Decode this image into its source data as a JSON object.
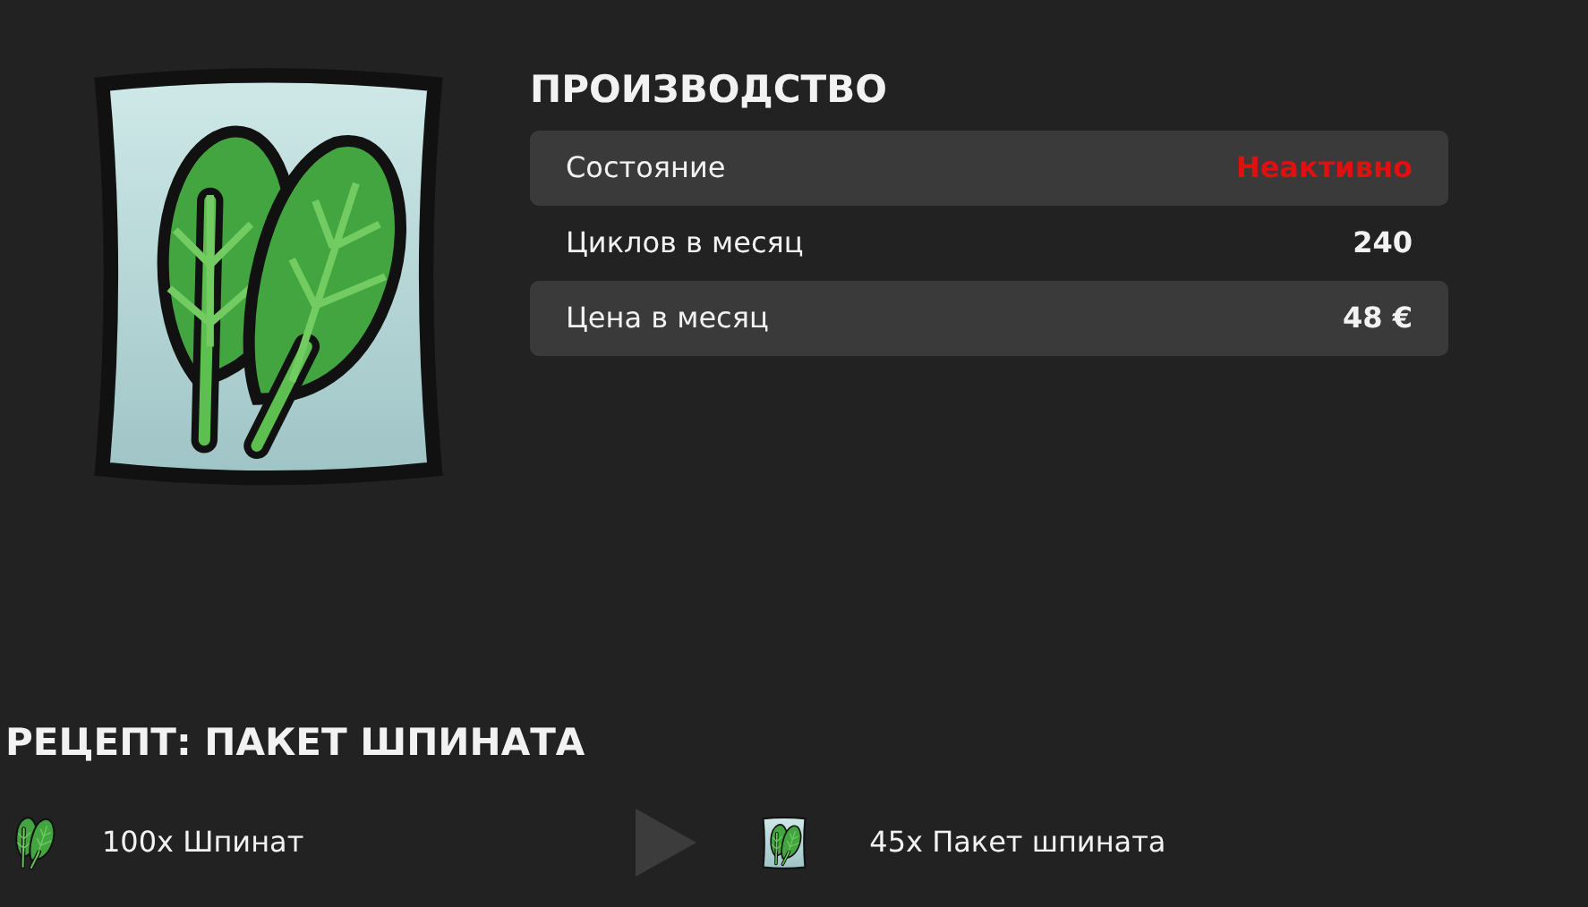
{
  "production": {
    "title": "ПРОИЗВОДСТВО",
    "rows": [
      {
        "label": "Состояние",
        "value": "Неактивно",
        "kind": "status",
        "active": false
      },
      {
        "label": "Циклов в месяц",
        "value": "240",
        "kind": "plain"
      },
      {
        "label": "Цена в месяц",
        "value": "48 €",
        "kind": "plain"
      }
    ]
  },
  "recipe": {
    "title": "РЕЦЕПТ: ПАКЕТ ШПИНАТА",
    "input": {
      "kind": "leaf",
      "text": "100x Шпинат"
    },
    "output": {
      "kind": "package",
      "text": "45x Пакет шпината"
    }
  }
}
